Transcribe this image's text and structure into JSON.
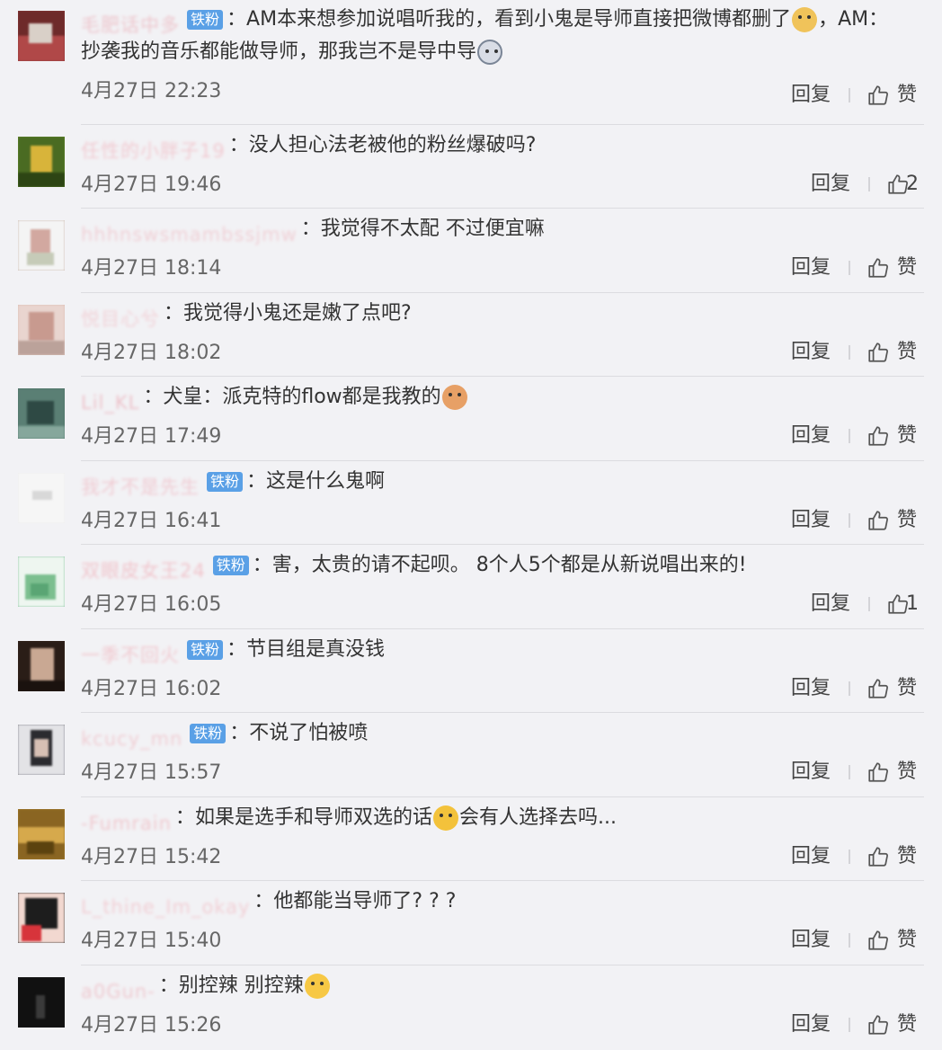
{
  "labels": {
    "reply": "回复",
    "like": "赞"
  },
  "badge_text": "铁粉",
  "comments": [
    {
      "username": "毛肥话中多",
      "badge": true,
      "text_parts": [
        "AM本来想参加说唱听我的，看到小鬼是导师直接把微博都删了",
        "，AM：抄袭我的音乐都能做导师，那我岂不是导中导"
      ],
      "emojis": [
        "doge",
        "husky"
      ],
      "time": "4月27日 22:23",
      "likes": "赞",
      "avatar_color": "#8c3b3b"
    },
    {
      "username": "任性的小胖子19",
      "badge": false,
      "text_parts": [
        "没人担心法老被他的粉丝爆破吗?"
      ],
      "emojis": [],
      "time": "4月27日 19:46",
      "likes": "2",
      "avatar_color": "#6b8f2e"
    },
    {
      "username": "hhhnswsmambssjmw",
      "badge": false,
      "text_parts": [
        "我觉得不太配 不过便宜嘛"
      ],
      "emojis": [],
      "time": "4月27日 18:14",
      "likes": "赞",
      "avatar_color": "#c7b3a8"
    },
    {
      "username": "悦目心兮",
      "badge": false,
      "text_parts": [
        "我觉得小鬼还是嫩了点吧?"
      ],
      "emojis": [],
      "time": "4月27日 18:02",
      "likes": "赞",
      "avatar_color": "#d9b8ad"
    },
    {
      "username": "Lil_KL",
      "badge": false,
      "text_parts": [
        "犬皇：派克特的flow都是我教的"
      ],
      "emojis": [
        "cat"
      ],
      "time": "4月27日 17:49",
      "likes": "赞",
      "avatar_color": "#4f6f66"
    },
    {
      "username": "我才不是先生",
      "badge": true,
      "text_parts": [
        "这是什么鬼啊"
      ],
      "emojis": [],
      "time": "4月27日 16:41",
      "likes": "赞",
      "avatar_color": "#ececec"
    },
    {
      "username": "双眼皮女王24",
      "badge": true,
      "text_parts": [
        "害，太贵的请不起呗。 8个人5个都是从新说唱出来的!"
      ],
      "emojis": [],
      "time": "4月27日 16:05",
      "likes": "1",
      "avatar_color": "#7fbf96"
    },
    {
      "username": "一季不回火",
      "badge": true,
      "text_parts": [
        "节目组是真没钱"
      ],
      "emojis": [],
      "time": "4月27日 16:02",
      "likes": "赞",
      "avatar_color": "#3b2a22"
    },
    {
      "username": "kcucy_mn",
      "badge": true,
      "text_parts": [
        "不说了怕被喷"
      ],
      "emojis": [],
      "time": "4月27日 15:57",
      "likes": "赞",
      "avatar_color": "#7d7d86"
    },
    {
      "username": "-Fumrain",
      "badge": false,
      "text_parts": [
        "如果是选手和导师双选的话",
        "会有人选择去吗..."
      ],
      "emojis": [
        "shy"
      ],
      "time": "4月27日 15:42",
      "likes": "赞",
      "avatar_color": "#a8822e"
    },
    {
      "username": "L_thine_Im_okay",
      "badge": false,
      "text_parts": [
        "他都能当导师了? ? ?"
      ],
      "emojis": [],
      "time": "4月27日 15:40",
      "likes": "赞",
      "avatar_color": "#222222"
    },
    {
      "username": "a0Gun-",
      "badge": false,
      "text_parts": [
        "别控辣 别控辣"
      ],
      "emojis": [
        "cry"
      ],
      "time": "4月27日 15:26",
      "likes": "赞",
      "avatar_color": "#1a1a1a"
    }
  ]
}
